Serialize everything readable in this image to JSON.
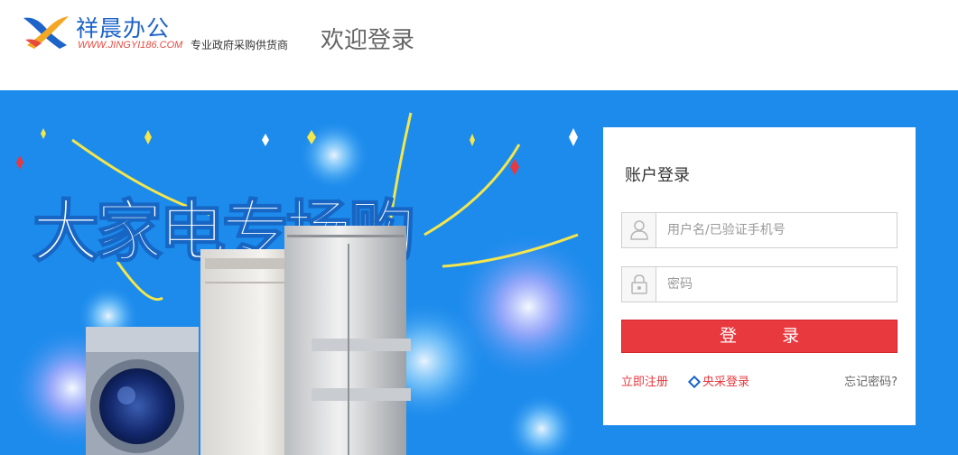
{
  "header": {
    "logo_name": "祥晨办公",
    "logo_url": "WWW.JINGYI186.COM",
    "tagline": "专业政府采购供货商",
    "welcome": "欢迎登录"
  },
  "banner": {
    "headline": "大家电专场购",
    "background_color": "#1c8bec"
  },
  "login": {
    "title": "账户登录",
    "username_placeholder": "用户名/已验证手机号",
    "password_placeholder": "密码",
    "submit_label": "登 录",
    "register_link": "立即注册",
    "central_login_link": "央采登录",
    "forgot_link": "忘记密码?",
    "accent_color": "#e8393f"
  }
}
